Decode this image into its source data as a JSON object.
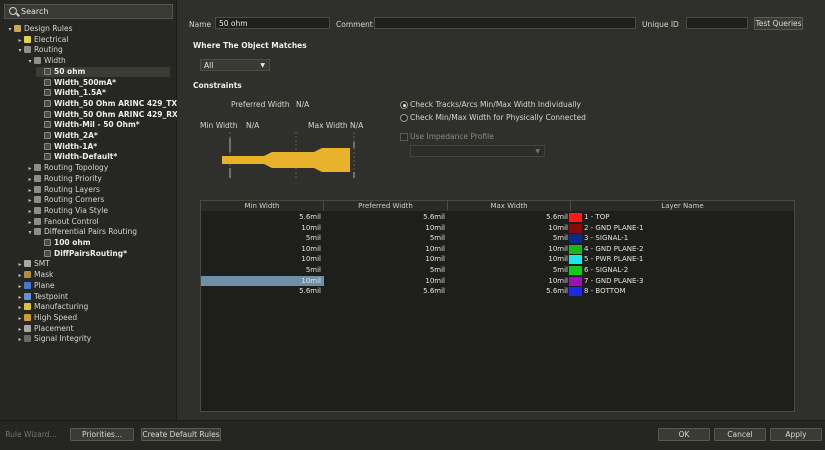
{
  "search": {
    "label": "Search"
  },
  "tree": [
    {
      "label": "Design Rules",
      "indent": 0,
      "arrow": "▾",
      "icon": "folder",
      "bold": false
    },
    {
      "label": "Electrical",
      "indent": 1,
      "arrow": "▸",
      "icon": "elec",
      "bold": false
    },
    {
      "label": "Routing",
      "indent": 1,
      "arrow": "▾",
      "icon": "route",
      "bold": false
    },
    {
      "label": "Width",
      "indent": 2,
      "arrow": "▾",
      "icon": "route",
      "bold": false
    },
    {
      "label": "50 ohm",
      "indent": 3,
      "arrow": "",
      "icon": "rule",
      "bold": true,
      "selected": true
    },
    {
      "label": "Width_500mA*",
      "indent": 3,
      "arrow": "",
      "icon": "rule",
      "bold": true
    },
    {
      "label": "Width_1.5A*",
      "indent": 3,
      "arrow": "",
      "icon": "rule",
      "bold": true
    },
    {
      "label": "Width_50 Ohm ARINC 429_TX",
      "indent": 3,
      "arrow": "",
      "icon": "rule",
      "bold": true
    },
    {
      "label": "Width_50 Ohm ARINC 429_RX",
      "indent": 3,
      "arrow": "",
      "icon": "rule",
      "bold": true
    },
    {
      "label": "Width-Mil - 50 Ohm*",
      "indent": 3,
      "arrow": "",
      "icon": "rule",
      "bold": true
    },
    {
      "label": "Width_2A*",
      "indent": 3,
      "arrow": "",
      "icon": "rule",
      "bold": true
    },
    {
      "label": "Width-1A*",
      "indent": 3,
      "arrow": "",
      "icon": "rule",
      "bold": true
    },
    {
      "label": "Width-Default*",
      "indent": 3,
      "arrow": "",
      "icon": "rule",
      "bold": true
    },
    {
      "label": "Routing Topology",
      "indent": 2,
      "arrow": "▸",
      "icon": "route",
      "bold": false
    },
    {
      "label": "Routing Priority",
      "indent": 2,
      "arrow": "▸",
      "icon": "route",
      "bold": false
    },
    {
      "label": "Routing Layers",
      "indent": 2,
      "arrow": "▸",
      "icon": "route",
      "bold": false
    },
    {
      "label": "Routing Corners",
      "indent": 2,
      "arrow": "▸",
      "icon": "route",
      "bold": false
    },
    {
      "label": "Routing Via Style",
      "indent": 2,
      "arrow": "▸",
      "icon": "route",
      "bold": false
    },
    {
      "label": "Fanout Control",
      "indent": 2,
      "arrow": "▸",
      "icon": "route",
      "bold": false
    },
    {
      "label": "Differential Pairs Routing",
      "indent": 2,
      "arrow": "▾",
      "icon": "route",
      "bold": false
    },
    {
      "label": "100 ohm",
      "indent": 3,
      "arrow": "",
      "icon": "rule",
      "bold": true
    },
    {
      "label": "DiffPairsRouting*",
      "indent": 3,
      "arrow": "",
      "icon": "rule",
      "bold": true
    },
    {
      "label": "SMT",
      "indent": 1,
      "arrow": "▸",
      "icon": "smt",
      "bold": false
    },
    {
      "label": "Mask",
      "indent": 1,
      "arrow": "▸",
      "icon": "mask",
      "bold": false
    },
    {
      "label": "Plane",
      "indent": 1,
      "arrow": "▸",
      "icon": "plane",
      "bold": false
    },
    {
      "label": "Testpoint",
      "indent": 1,
      "arrow": "▸",
      "icon": "test",
      "bold": false
    },
    {
      "label": "Manufacturing",
      "indent": 1,
      "arrow": "▸",
      "icon": "manu",
      "bold": false
    },
    {
      "label": "High Speed",
      "indent": 1,
      "arrow": "▸",
      "icon": "hs",
      "bold": false
    },
    {
      "label": "Placement",
      "indent": 1,
      "arrow": "▸",
      "icon": "place",
      "bold": false
    },
    {
      "label": "Signal Integrity",
      "indent": 1,
      "arrow": "▸",
      "icon": "sig",
      "bold": false
    }
  ],
  "header": {
    "name_label": "Name",
    "name_value": "50 ohm",
    "comment_label": "Comment",
    "comment_value": "",
    "uid_label": "Unique ID",
    "uid_value": "",
    "test_queries": "Test Queries"
  },
  "where": {
    "title": "Where The Object Matches",
    "selected": "All"
  },
  "constraints": {
    "title": "Constraints",
    "preferred_width_label": "Preferred Width",
    "preferred_width_value": "N/A",
    "min_width_label": "Min Width",
    "min_width_value": "N/A",
    "max_width_label": "Max Width",
    "max_width_value": "N/A",
    "radio1": "Check Tracks/Arcs Min/Max Width Individually",
    "radio2": "Check Min/Max Width for Physically Connected",
    "use_impedance": "Use Impedance Profile",
    "radio1_selected": true
  },
  "table": {
    "headers": [
      "Min Width",
      "Preferred Width",
      "Max Width",
      "Layer Name"
    ],
    "rows": [
      {
        "min": "5.6mil",
        "pref": "5.6mil",
        "max": "5.6mil",
        "layer": "1 - TOP",
        "color": "#ff1a1a"
      },
      {
        "min": "10mil",
        "pref": "10mil",
        "max": "10mil",
        "layer": "2 - GND PLANE-1",
        "color": "#8a0a0a"
      },
      {
        "min": "5mil",
        "pref": "5mil",
        "max": "5mil",
        "layer": "3 - SIGNAL-1",
        "color": "#0d2a8a"
      },
      {
        "min": "10mil",
        "pref": "10mil",
        "max": "10mil",
        "layer": "4 - GND PLANE-2",
        "color": "#16b81e"
      },
      {
        "min": "10mil",
        "pref": "10mil",
        "max": "10mil",
        "layer": "5 - PWR PLANE-1",
        "color": "#19e8e8"
      },
      {
        "min": "5mil",
        "pref": "5mil",
        "max": "5mil",
        "layer": "6 - SIGNAL-2",
        "color": "#16c81e"
      },
      {
        "min": "10mil",
        "pref": "10mil",
        "max": "10mil",
        "layer": "7 - GND PLANE-3",
        "color": "#9a10b8"
      },
      {
        "min": "5.6mil",
        "pref": "5.6mil",
        "max": "5.6mil",
        "layer": "8 - BOTTOM",
        "color": "#1a2ae8"
      }
    ],
    "selected_row_index": 6
  },
  "footer": {
    "rule_wizard": "Rule Wizard...",
    "priorities": "Priorities...",
    "create_default": "Create Default Rules",
    "ok": "OK",
    "cancel": "Cancel",
    "apply": "Apply"
  },
  "colors": {
    "track": "#e8b22a",
    "selection": "#6f8ea8"
  }
}
